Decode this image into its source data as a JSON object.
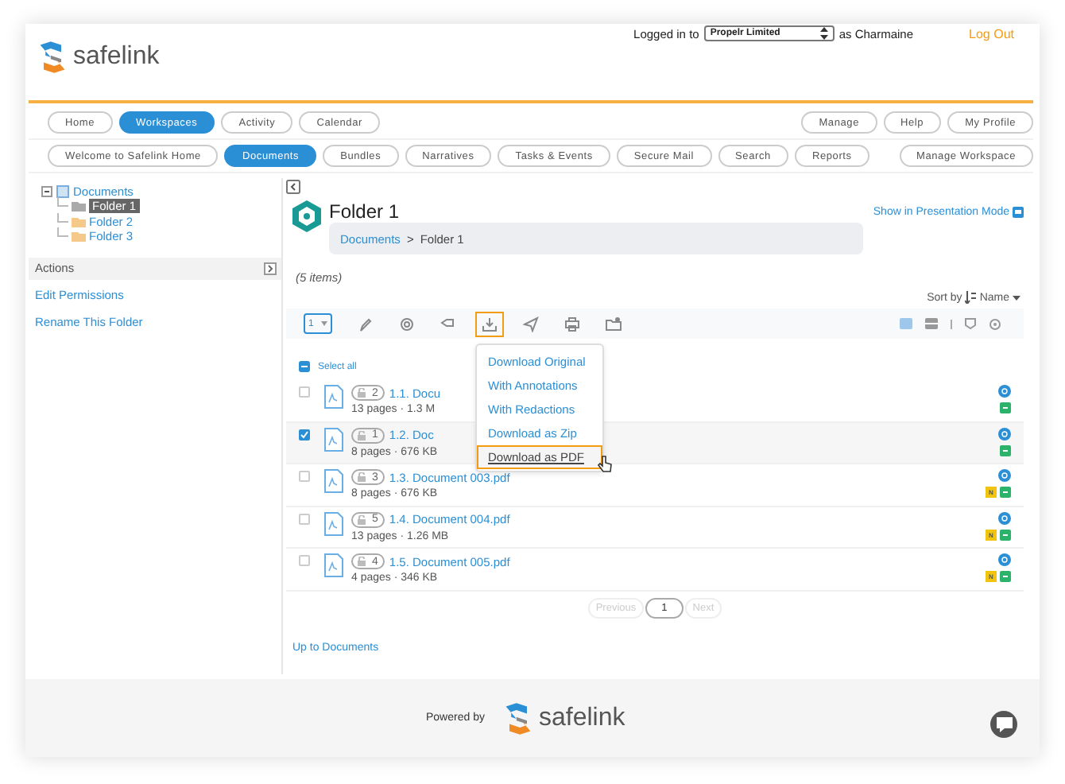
{
  "header": {
    "logo_text": "safelink",
    "logged_in_label": "Logged in to",
    "organization": "Propelr Limited",
    "user_label": "as Charmaine",
    "logout": "Log Out"
  },
  "nav_primary": [
    {
      "label": "Home",
      "selected": false
    },
    {
      "label": "Workspaces",
      "selected": true
    },
    {
      "label": "Activity",
      "selected": false
    },
    {
      "label": "Calendar",
      "selected": false
    }
  ],
  "nav_primary_right": [
    "Manage",
    "Help",
    "My Profile"
  ],
  "nav_secondary": [
    {
      "label": "Welcome to Safelink Home",
      "selected": false
    },
    {
      "label": "Documents",
      "selected": true
    },
    {
      "label": "Bundles",
      "selected": false
    },
    {
      "label": "Narratives",
      "selected": false
    },
    {
      "label": "Tasks & Events",
      "selected": false
    },
    {
      "label": "Secure Mail",
      "selected": false
    },
    {
      "label": "Search",
      "selected": false
    },
    {
      "label": "Reports",
      "selected": false
    }
  ],
  "nav_secondary_right": [
    "Manage Workspace"
  ],
  "tree": {
    "label": "Documents",
    "expanded": true,
    "children": [
      {
        "label": "Folder 1",
        "selected": true
      },
      {
        "label": "Folder 2",
        "selected": false
      },
      {
        "label": "Folder 3",
        "selected": false
      }
    ]
  },
  "actions": {
    "title": "Actions",
    "links": [
      "Edit Permissions",
      "Rename This Folder"
    ]
  },
  "folder": {
    "title": "Folder 1",
    "breadcrumb": [
      "Documents",
      "Folder 1"
    ],
    "separator": ">",
    "presentation_link": "Show in Presentation Mode",
    "item_count": "(5 items)"
  },
  "sort": {
    "label": "Sort by",
    "value": "Name"
  },
  "toolbar": {
    "page_select": "1",
    "tools": [
      {
        "kind": "pencil",
        "active": false
      },
      {
        "kind": "gear",
        "active": false
      },
      {
        "kind": "tag",
        "active": false
      },
      {
        "kind": "download",
        "active": true
      },
      {
        "kind": "send",
        "active": false
      },
      {
        "kind": "print",
        "active": false
      },
      {
        "kind": "folder",
        "active": false
      }
    ]
  },
  "select_all": "Select all",
  "download_menu": [
    {
      "label": "Download Original",
      "selected": false
    },
    {
      "label": "With Annotations",
      "selected": false
    },
    {
      "label": "With Redactions",
      "selected": false
    },
    {
      "label": "Download as Zip",
      "selected": false
    },
    {
      "label": "Download as PDF",
      "selected": true
    }
  ],
  "documents": [
    {
      "checked": false,
      "version": "2",
      "name": "1.1. Docu",
      "meta": "13 pages · 1.3 M"
    },
    {
      "checked": true,
      "version": "1",
      "name": "1.2. Doc",
      "meta": "8 pages · 676 KB"
    },
    {
      "checked": false,
      "version": "3",
      "name": "1.3. Document 003.pdf",
      "meta": "8 pages · 676 KB",
      "note_tag": "N"
    },
    {
      "checked": false,
      "version": "5",
      "name": "1.4. Document 004.pdf",
      "meta": "13 pages · 1.26 MB",
      "note_tag": "N"
    },
    {
      "checked": false,
      "version": "4",
      "name": "1.5. Document 005.pdf",
      "meta": "4 pages · 346 KB",
      "note_tag": "N"
    }
  ],
  "pagination": {
    "previous": "Previous",
    "page": "1",
    "next": "Next",
    "previous_disabled": true,
    "next_disabled": true
  },
  "up_link": "Up to Documents",
  "footer": {
    "powered_by": "Powered by",
    "logo_text": "safelink"
  }
}
